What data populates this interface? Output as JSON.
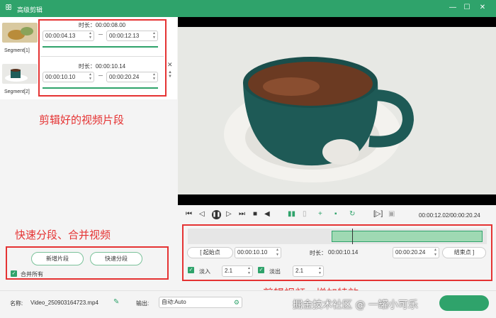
{
  "titlebar": {
    "title": "高级剪辑",
    "minimize": "—",
    "maximize": "☐",
    "close": "✕"
  },
  "segments": [
    {
      "label": "Segment[1]",
      "duration": "时长：00:00:08.00",
      "start": "00:00:04.13",
      "end": "00:00:12.13",
      "progress": 1.0
    },
    {
      "label": "Segment[2]",
      "duration": "时长：00:00:10.14",
      "start": "00:00:10.10",
      "end": "00:00:20.24",
      "progress": 1.0
    }
  ],
  "segment_delete_icon": "✕",
  "annotations": {
    "segments": "剪辑好的视频片段",
    "split_merge": "快速分段、合并视频",
    "effects": "剪辑视频，增加特效"
  },
  "left_buttons": {
    "add_segment": "新增片段",
    "quick_split": "快速分段",
    "merge_all": "合并所有",
    "merge_all_checked": true
  },
  "player": {
    "time_readout": "00:00:12.02/00:00:20.24",
    "playhead_fraction": 0.55
  },
  "editor": {
    "start_btn": "[ 起始点",
    "start_value": "00:00:10.10",
    "duration_label": "时长：",
    "duration_value": "00:00:10.14",
    "end_value": "00:00:20.24",
    "end_btn": "结束点 ]",
    "fade_in_label": "淡入",
    "fade_in_value": "2.1",
    "fade_in_checked": true,
    "fade_out_label": "淡出",
    "fade_out_value": "2.1",
    "fade_out_checked": true,
    "selection_start": 0.48,
    "selection_end": 1.0
  },
  "bottom": {
    "name_label": "名称:",
    "name_value": "Video_250903164723.mp4",
    "output_label": "输出:",
    "output_value": "自动:Auto"
  },
  "watermark": "掘金技术社区 @ 一罐小可乐",
  "colors": {
    "accent": "#2fa36b",
    "annotation": "#e53333"
  }
}
